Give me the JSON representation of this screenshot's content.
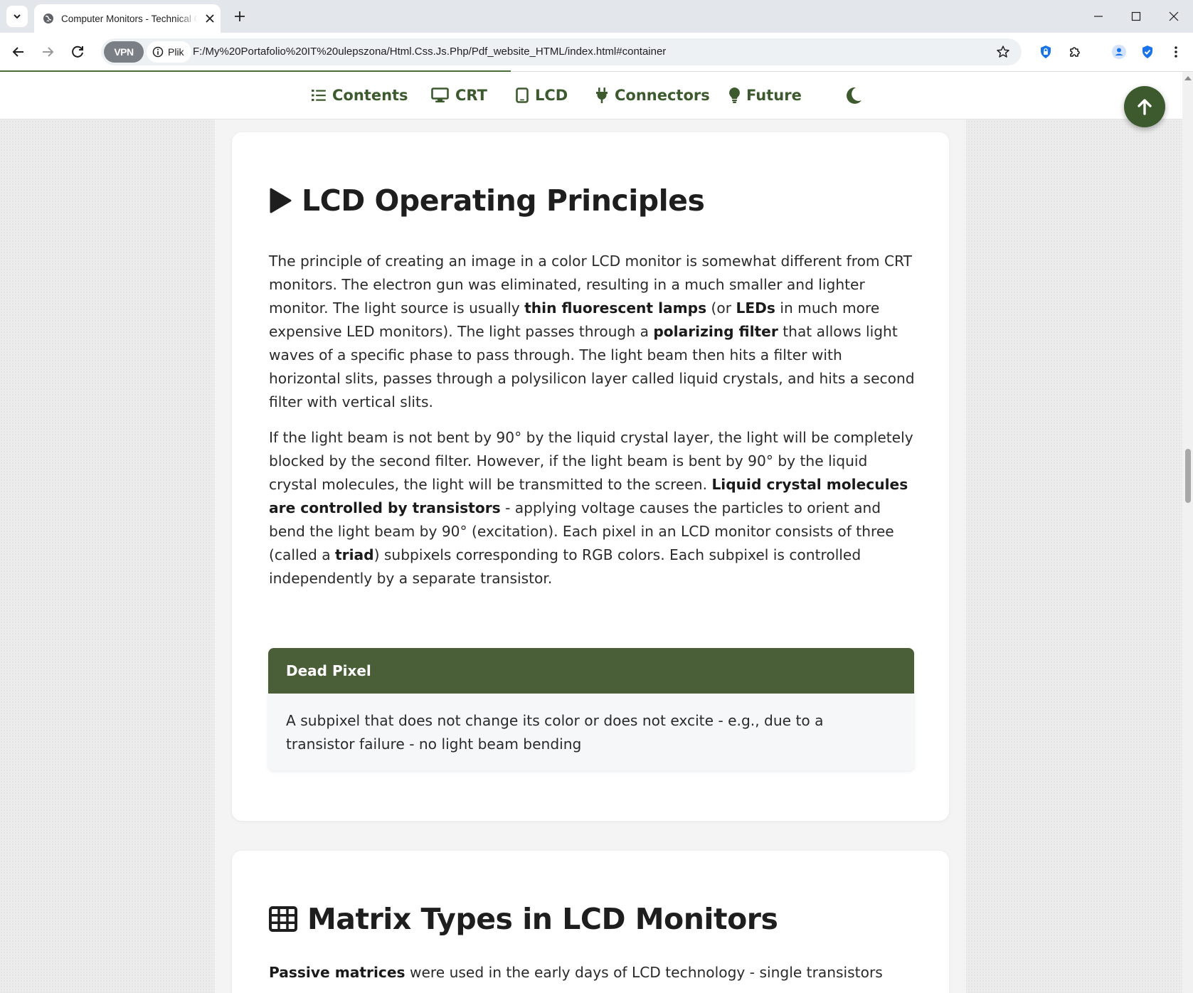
{
  "browser": {
    "tab_title": "Computer Monitors - Technical Overview",
    "vpn_label": "VPN",
    "site_chip_label": "Plik",
    "url": "F:/My%20Portafolio%20IT%20ulepszona/Html.Css.Js.Php/Pdf_website_HTML/index.html#container"
  },
  "nav": {
    "links": [
      {
        "label": "Contents",
        "icon": "list-icon"
      },
      {
        "label": "CRT",
        "icon": "desktop-icon"
      },
      {
        "label": "LCD",
        "icon": "tablet-icon"
      },
      {
        "label": "Connectors",
        "icon": "plug-icon"
      },
      {
        "label": "Future",
        "icon": "lightbulb-icon"
      }
    ],
    "theme_icon": "moon-icon",
    "back_to_top_icon": "arrow-up-icon"
  },
  "section1": {
    "heading": "LCD Operating Principles",
    "heading_icon": "play-icon",
    "paragraph1": {
      "t1": "The principle of creating an image in a color LCD monitor is somewhat different from CRT monitors. The electron gun was eliminated, resulting in a much smaller and lighter monitor. The light source is usually ",
      "b1": "thin fluorescent lamps",
      "t2": " (or ",
      "b2": "LEDs",
      "t3": " in much more expensive LED monitors). The light passes through a ",
      "b3": "polarizing filter",
      "t4": " that allows light waves of a specific phase to pass through. The light beam then hits a filter with horizontal slits, passes through a polysilicon layer called liquid crystals, and hits a second filter with vertical slits."
    },
    "paragraph2": {
      "t1": "If the light beam is not bent by 90° by the liquid crystal layer, the light will be completely blocked by the second filter. However, if the light beam is bent by 90° by the liquid crystal molecules, the light will be transmitted to the screen. ",
      "b1": "Liquid crystal molecules are controlled by transistors",
      "t2": " - applying voltage causes the particles to orient and bend the light beam by 90° (excitation). Each pixel in an LCD monitor consists of three (called a ",
      "b2": "triad",
      "t3": ") subpixels corresponding to RGB colors. Each subpixel is controlled independently by a separate transistor."
    },
    "definition": {
      "title": "Dead Pixel",
      "body": "A subpixel that does not change its color or does not excite - e.g., due to a transistor failure - no light beam bending"
    }
  },
  "section2": {
    "heading": "Matrix Types in LCD Monitors",
    "heading_icon": "table-icon",
    "intro_bold": "Passive matrices",
    "intro_text": " were used in the early days of LCD technology - single transistors"
  },
  "colors": {
    "accent": "#3d5a2e",
    "definition_header": "#4a5e37",
    "heading_text": "#1e1e1e"
  }
}
